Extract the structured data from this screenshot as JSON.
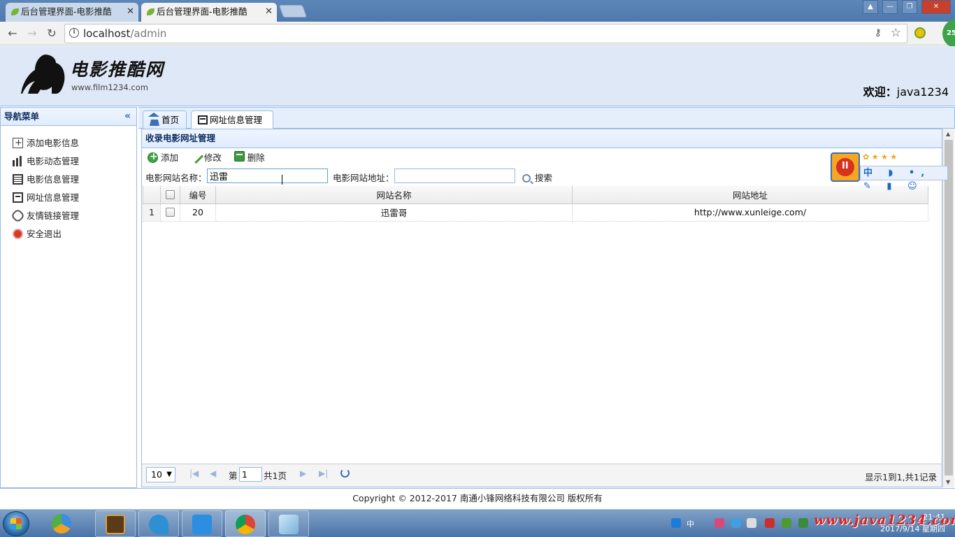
{
  "browser": {
    "tabs": [
      {
        "title": "后台管理界面-电影推酷",
        "active": false
      },
      {
        "title": "后台管理界面-电影推酷",
        "active": true
      }
    ],
    "url_host": "localhost",
    "url_path": "/admin",
    "badge": "25"
  },
  "header": {
    "brand": "电影推酷网",
    "brand_url": "www.film1234.com",
    "welcome_label": "欢迎：",
    "username": "java1234"
  },
  "nav": {
    "title": "导航菜单",
    "items": [
      {
        "label": "添加电影信息",
        "icon": "add-icon"
      },
      {
        "label": "电影动态管理",
        "icon": "bar-chart-icon"
      },
      {
        "label": "电影信息管理",
        "icon": "film-icon"
      },
      {
        "label": "网址信息管理",
        "icon": "website-icon"
      },
      {
        "label": "友情链接管理",
        "icon": "link-icon"
      },
      {
        "label": "安全退出",
        "icon": "exit-icon"
      }
    ]
  },
  "tabs": [
    {
      "label": "首页"
    },
    {
      "label": "网址信息管理",
      "close": "×"
    }
  ],
  "panel": {
    "title": "收录电影网址管理",
    "toolbar": {
      "add": "添加",
      "edit": "修改",
      "delete": "删除"
    },
    "search": {
      "name_label": "电影网站名称：",
      "name_value": "迅雷",
      "url_label": "电影网站地址：",
      "url_value": "",
      "search_label": "搜索"
    },
    "grid": {
      "columns": [
        "编号",
        "网站名称",
        "网站地址"
      ],
      "rows": [
        {
          "rownum": "1",
          "id": "20",
          "name": "迅雷哥",
          "url": "http://www.xunleige.com/"
        }
      ]
    },
    "pager": {
      "page_size": "10",
      "page_prefix": "第",
      "page_number": "1",
      "page_suffix": "共1页",
      "summary": "显示1到1,共1记录"
    }
  },
  "footer": {
    "copyright": "Copyright © 2012-2017 南通小锋网络科技有限公司 版权所有"
  },
  "ime": {
    "bar_text": "中 ◗ •, ✎ ▮ ☺"
  },
  "taskbar": {
    "time": "21:41",
    "date": "2017/9/14 星期四",
    "watermark": "www.java1234.com"
  },
  "colors": {
    "header_bg": "#dfe8f6",
    "panel_border": "#99bbe8",
    "panel_header_bg": "#e0ecff",
    "titlebar_blue": "#4f79ad"
  }
}
